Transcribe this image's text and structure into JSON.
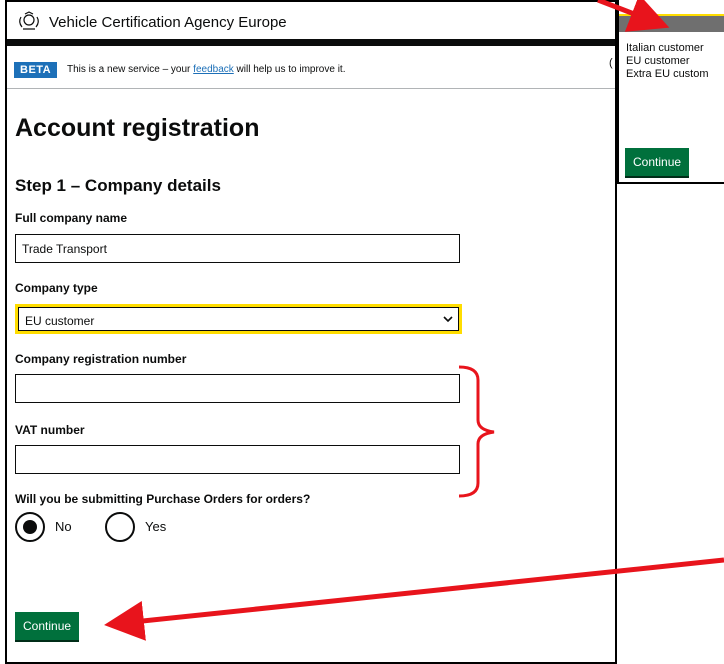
{
  "header": {
    "site_name": "Vehicle Certification Agency Europe"
  },
  "beta": {
    "tag": "BETA",
    "text_before": "This is a new service – your ",
    "link": "feedback",
    "text_after": " will help us to improve it."
  },
  "page": {
    "title": "Account registration",
    "step_title": "Step 1 – Company details"
  },
  "form": {
    "company_name": {
      "label": "Full company name",
      "value": "Trade Transport"
    },
    "company_type": {
      "label": "Company type",
      "selected": "EU customer"
    },
    "registration_number": {
      "label": "Company registration number",
      "value": ""
    },
    "vat_number": {
      "label": "VAT number",
      "value": ""
    },
    "purchase_orders": {
      "question": "Will you be submitting Purchase Orders for orders?",
      "options": [
        "No",
        "Yes"
      ],
      "selected": "No"
    },
    "continue_label": "Continue"
  },
  "inset": {
    "options": [
      "Italian customer",
      "EU customer",
      "Extra EU custom"
    ],
    "partial_char": "(",
    "continue_label": "Continue"
  },
  "annotation": {
    "color": "#e8141c",
    "highlight": "#ffdd00"
  }
}
